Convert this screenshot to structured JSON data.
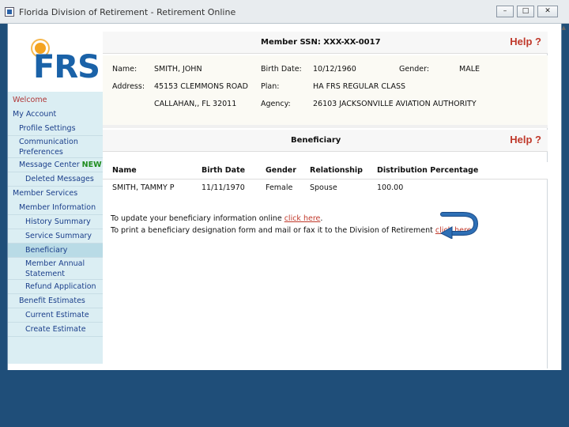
{
  "window": {
    "title": "Florida Division of Retirement - Retirement Online",
    "buttons": {
      "minimize": "–",
      "maximize": "□",
      "close": "✕"
    }
  },
  "logo": {
    "text": "FRS"
  },
  "member_header": {
    "title": "Member SSN: XXX-XX-0017",
    "help": "Help ?"
  },
  "member": {
    "name_label": "Name:",
    "name": "SMITH, JOHN",
    "birth_label": "Birth Date:",
    "birth": "10/12/1960",
    "gender_label": "Gender:",
    "gender": "MALE",
    "address_label": "Address:",
    "address1": "45153 CLEMMONS ROAD",
    "address2": "CALLAHAN,, FL 32011",
    "plan_label": "Plan:",
    "plan": "HA FRS REGULAR CLASS",
    "agency_label": "Agency:",
    "agency": "26103 JACKSONVILLE AVIATION AUTHORITY"
  },
  "beneficiary_header": {
    "title": "Beneficiary",
    "help": "Help ?"
  },
  "beneficiary_table": {
    "columns": [
      "Name",
      "Birth Date",
      "Gender",
      "Relationship",
      "Distribution Percentage"
    ],
    "rows": [
      {
        "name": "SMITH, TAMMY P",
        "birth": "11/11/1970",
        "gender": "Female",
        "relationship": "Spouse",
        "percent": "100.00"
      }
    ]
  },
  "instructions": {
    "line1_text": "To update your beneficiary information online ",
    "line1_link": "click here",
    "line1_end": ".",
    "line2_text": "To print a beneficiary designation form and mail or fax it to the Division of Retirement ",
    "line2_link": "click here",
    "line2_end": "."
  },
  "nav": {
    "welcome": "Welcome",
    "my_account": "My Account",
    "profile_settings": "Profile Settings",
    "communication_1": "Communication",
    "communication_2": "Preferences",
    "message_center": "Message Center",
    "new_tag": "NEW!",
    "deleted_messages": "Deleted Messages",
    "member_services": "Member Services",
    "member_information": "Member Information",
    "history_summary": "History Summary",
    "service_summary": "Service Summary",
    "beneficiary": "Beneficiary",
    "annual_1": "Member Annual",
    "annual_2": "Statement",
    "refund_application": "Refund Application",
    "benefit_estimates": "Benefit Estimates",
    "current_estimate": "Current Estimate",
    "create_estimate": "Create Estimate"
  },
  "colors": {
    "accent_link": "#c0392b",
    "nav_text": "#1b3f8b",
    "sidebar_bg": "#dbeef3",
    "frame_blue": "#1f4e79",
    "arrow_blue": "#2e6fb5"
  },
  "icons": {
    "window_icon": "app-window-icon",
    "arrow": "u-turn-arrow-icon"
  }
}
